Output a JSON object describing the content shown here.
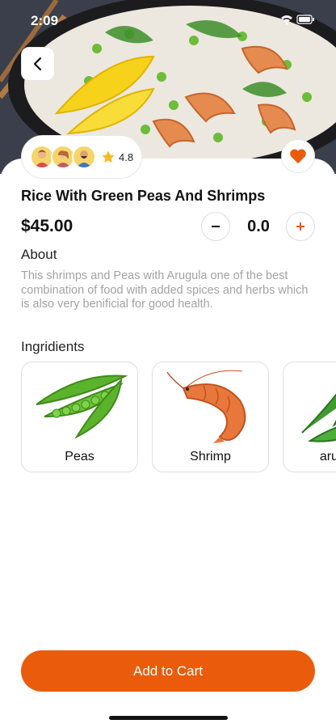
{
  "status_bar": {
    "time": "2:09"
  },
  "product": {
    "title": "Rice With Green Peas And Shrimps",
    "price": "$45.00",
    "rating": "4.8",
    "quantity": "0.0"
  },
  "about": {
    "heading": "About",
    "text": "This shrimps and Peas with Arugula one of the best combination of food with added spices and herbs which is also very benificial for good health."
  },
  "ingredients": {
    "heading": "Ingridients",
    "items": [
      {
        "label": "Peas",
        "icon": "peas-icon"
      },
      {
        "label": "Shrimp",
        "icon": "shrimp-icon"
      },
      {
        "label": "arugula",
        "icon": "arugula-icon"
      }
    ]
  },
  "actions": {
    "add_to_cart": "Add to Cart"
  },
  "colors": {
    "accent": "#ea5b0c",
    "muted_text": "#a3a3a3"
  },
  "icons": [
    "back-arrow-icon",
    "heart-icon",
    "star-icon",
    "minus-icon",
    "plus-icon",
    "wifi-icon",
    "battery-icon"
  ]
}
